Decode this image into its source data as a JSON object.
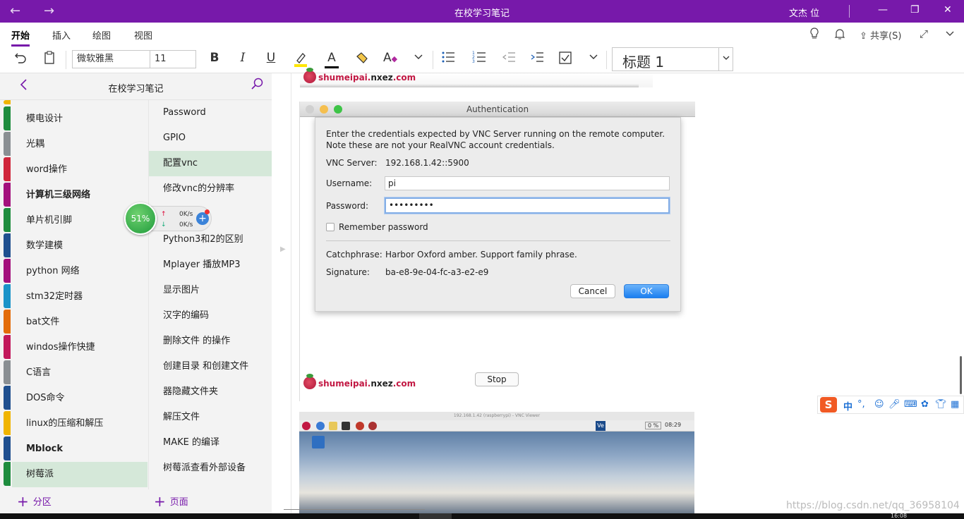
{
  "window": {
    "title": "在校学习笔记",
    "user": "文杰 位",
    "back_icon": "←",
    "forward_icon": "→",
    "min_icon": "—",
    "restore_icon": "❐",
    "close_icon": "✕"
  },
  "ribbon": {
    "tabs": [
      "开始",
      "插入",
      "绘图",
      "视图"
    ],
    "share_label": "共享(S)"
  },
  "toolbar": {
    "font_name": "微软雅黑",
    "font_size": "11",
    "style_value": "标题 1",
    "bold": "B",
    "italic": "I",
    "underline": "U",
    "font_color_letter": "A",
    "format_letter": "A"
  },
  "sidebar": {
    "notebook_title": "在校学习笔记",
    "sections": [
      {
        "label": "模电设计",
        "color": "#1e8c3e"
      },
      {
        "label": "光耦",
        "color": "#8a8f93"
      },
      {
        "label": "word操作",
        "color": "#d0263b"
      },
      {
        "label": "计算机三级网络",
        "color": "#a3107c",
        "bold": true
      },
      {
        "label": "单片机引脚",
        "color": "#1e8c3e"
      },
      {
        "label": "数学建模",
        "color": "#1f4f8f"
      },
      {
        "label": "python 网络",
        "color": "#a3107c"
      },
      {
        "label": "stm32定时器",
        "color": "#1a93c8"
      },
      {
        "label": "bat文件",
        "color": "#e36c0a"
      },
      {
        "label": "windos操作快捷",
        "color": "#c2185b"
      },
      {
        "label": "C语言",
        "color": "#8a8f93"
      },
      {
        "label": "DOS命令",
        "color": "#1f4f8f"
      },
      {
        "label": "linux的压缩和解压",
        "color": "#f0b400"
      },
      {
        "label": "Mblock",
        "color": "#1f4f8f",
        "bold": true
      },
      {
        "label": "树莓派",
        "color": "#1e8c3e",
        "selected": true
      }
    ],
    "pages": [
      {
        "label": "Password"
      },
      {
        "label": "GPIO"
      },
      {
        "label": "配置vnc",
        "selected": true
      },
      {
        "label": "修改vnc的分辨率"
      },
      {
        "label": ""
      },
      {
        "label": "Python3和2的区别"
      },
      {
        "label": "Mplayer 播放MP3"
      },
      {
        "label": "显示图片"
      },
      {
        "label": "汉字的编码"
      },
      {
        "label": "删除文件 的操作"
      },
      {
        "label": "创建目录  和创建文件"
      },
      {
        "label": "器隐藏文件夹"
      },
      {
        "label": "解压文件"
      },
      {
        "label": "MAKE 的编译"
      },
      {
        "label": "树莓派查看外部设备"
      }
    ],
    "add_section": "分区",
    "add_page": "页面"
  },
  "net_widget": {
    "percent": "51%",
    "up_speed": "0K/s",
    "down_speed": "0K/s"
  },
  "content": {
    "logo_text_red": "shumeipai.",
    "logo_text_dark": "nxez",
    "logo_text_red2": ".com",
    "auth_window_title": "Authentication",
    "auth_line1": "Enter the credentials expected by VNC Server running on the remote computer.",
    "auth_line2": "Note these are not your RealVNC account credentials.",
    "vnc_server_label": "VNC Server:",
    "vnc_server_value": "192.168.1.42::5900",
    "username_label": "Username:",
    "username_value": "pi",
    "password_label": "Password:",
    "password_value": "•••••••••",
    "remember_label": "Remember password",
    "catchphrase_label": "Catchphrase:",
    "catchphrase_value": "Harbor Oxford amber. Support family phrase.",
    "signature_label": "Signature:",
    "signature_value": "ba-e8-9e-04-fc-a3-e2-e9",
    "cancel_label": "Cancel",
    "ok_label": "OK",
    "stop_label": "Stop",
    "vnc_viewer_title": "192.168.1.42 (raspberrypi) - VNC Viewer",
    "rpi_clock": "08:29",
    "rpi_cpu": "0 %",
    "rpi_ve": "Ve"
  },
  "ime": {
    "logo": "S",
    "mode": "中",
    "punct": "°,"
  },
  "watermark": "https://blog.csdn.net/qq_36958104",
  "taskbar_clock": "16:08"
}
